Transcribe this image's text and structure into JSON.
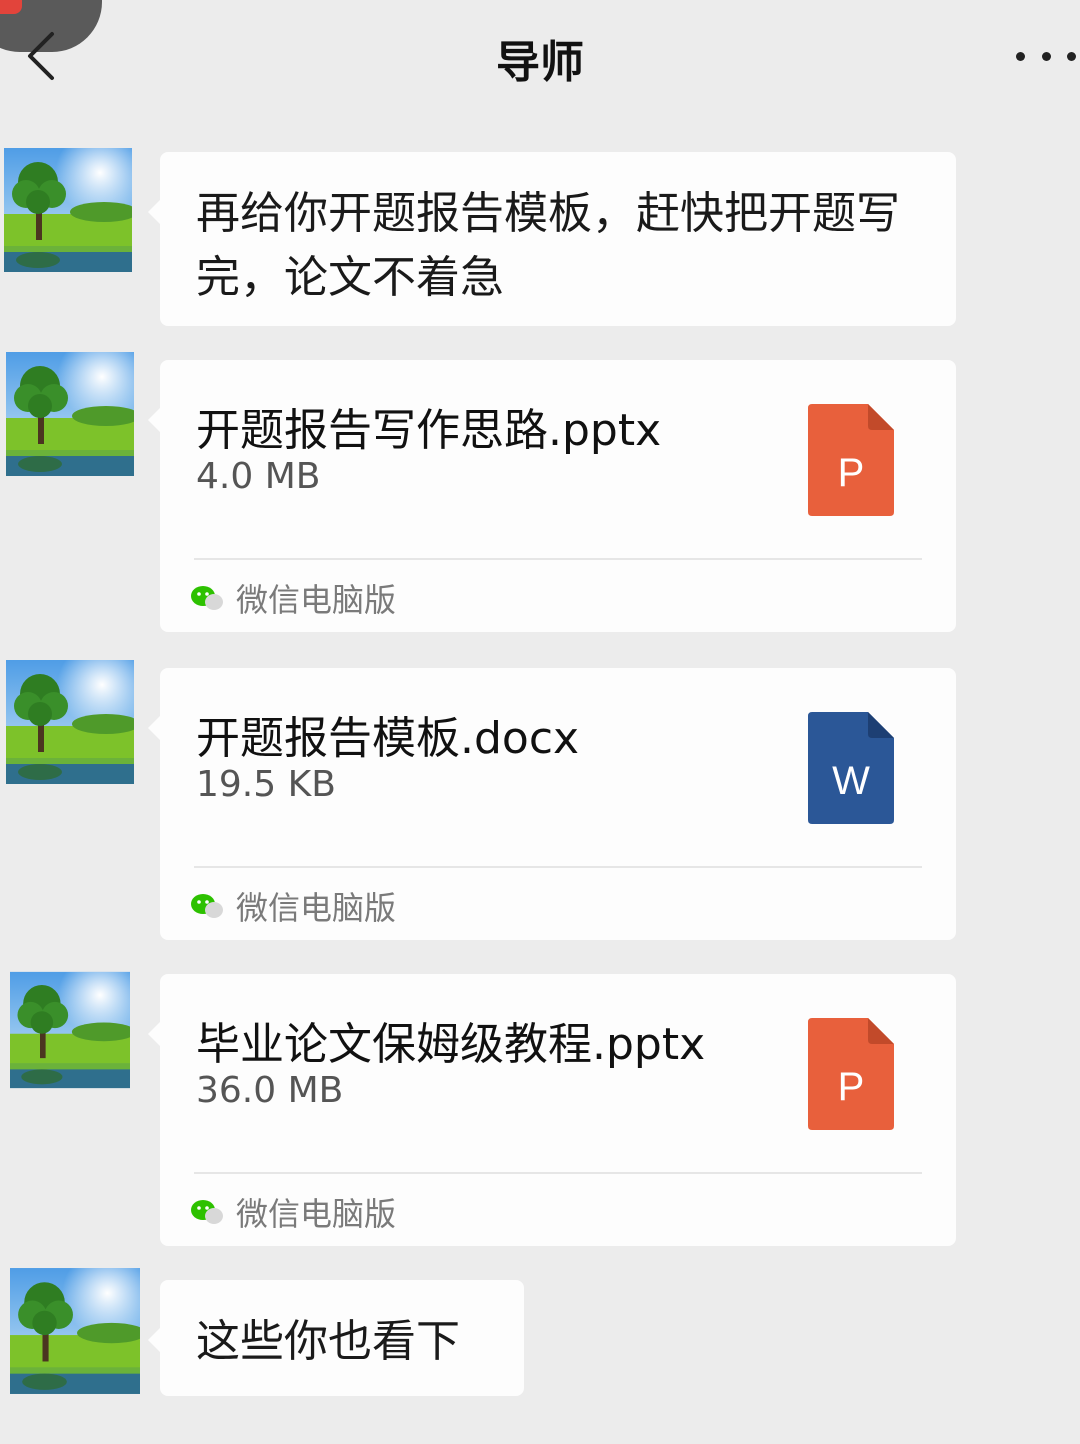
{
  "header": {
    "title": "导师",
    "back_icon": "chevron-left-icon",
    "more_icon": "more-dots-icon"
  },
  "messages": [
    {
      "type": "text",
      "text": "再给你开题报告模板，赶快把开题写完，论文不着急"
    },
    {
      "type": "file",
      "name": "开题报告写作思路.pptx",
      "size": "4.0 MB",
      "icon_letter": "P",
      "icon_color": "#e8603c",
      "source": "微信电脑版"
    },
    {
      "type": "file",
      "name": "开题报告模板.docx",
      "size": "19.5 KB",
      "icon_letter": "W",
      "icon_color": "#2b5797",
      "source": "微信电脑版"
    },
    {
      "type": "file",
      "name": "毕业论文保姆级教程.pptx",
      "size": "36.0 MB",
      "icon_letter": "P",
      "icon_color": "#e8603c",
      "source": "微信电脑版"
    },
    {
      "type": "text",
      "text": "这些你也看下"
    }
  ],
  "colors": {
    "background": "#ececec",
    "bubble": "#fdfdfd",
    "ppt": "#e8603c",
    "word": "#2b5797",
    "wechat_green": "#2dc100"
  }
}
